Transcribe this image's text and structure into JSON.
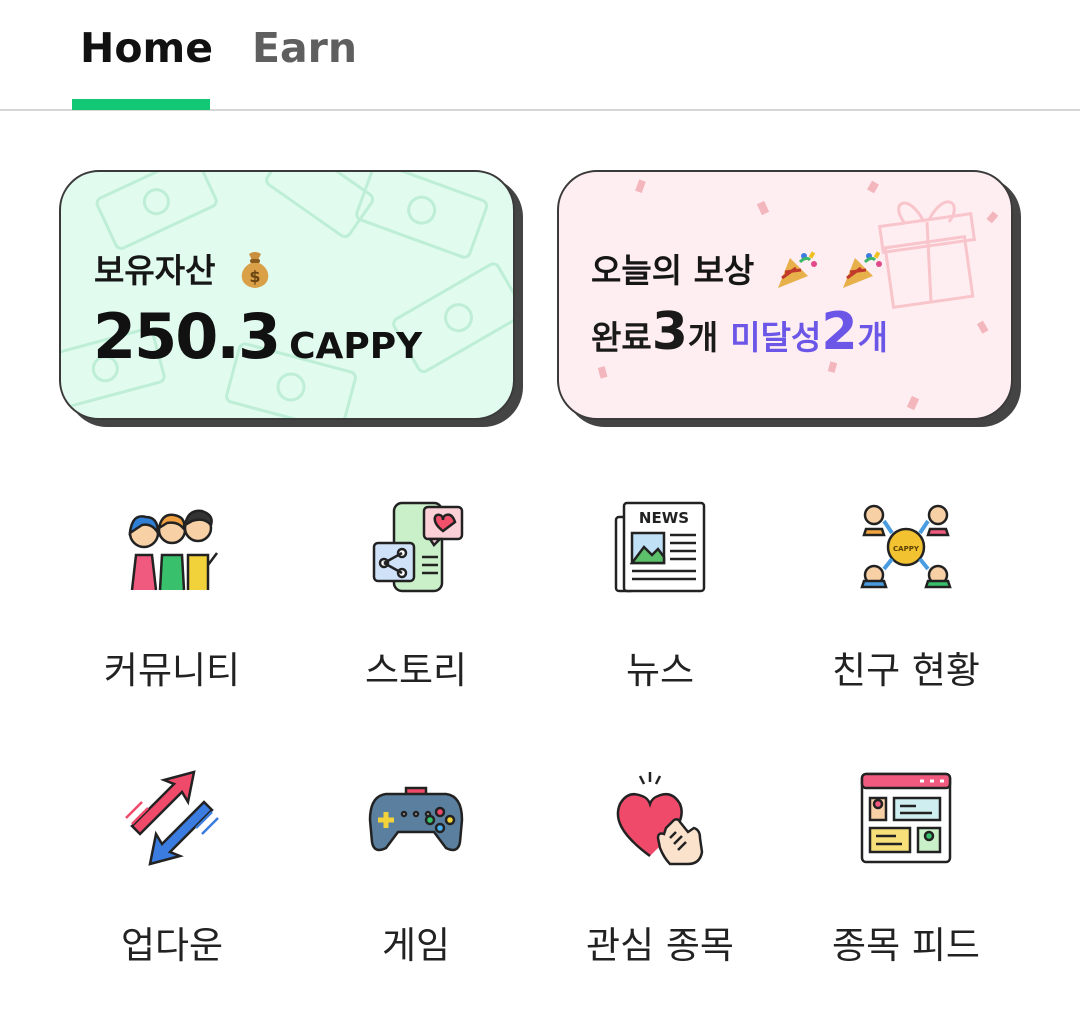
{
  "tabs": [
    {
      "label": "Home",
      "active": true
    },
    {
      "label": "Earn",
      "active": false
    }
  ],
  "accent_color": "#13c874",
  "assets_card": {
    "title": "보유자산",
    "emoji": "money-bag-icon",
    "amount": "250.3",
    "unit": "CAPPY",
    "bg_color": "#e1fbef"
  },
  "reward_card": {
    "title": "오늘의 보상",
    "emoji": "party-popper-icon",
    "completed_label": "완료",
    "completed_count": "3",
    "completed_unit": "개",
    "pending_label": "미달성",
    "pending_count": "2",
    "pending_unit": "개",
    "pending_color": "#6b56e8",
    "bg_color": "#ffeef1"
  },
  "menu": [
    {
      "label": "커뮤니티",
      "icon": "community-people-icon"
    },
    {
      "label": "스토리",
      "icon": "story-share-icon"
    },
    {
      "label": "뉴스",
      "icon": "newspaper-icon"
    },
    {
      "label": "친구 현황",
      "icon": "friends-network-icon"
    },
    {
      "label": "업다운",
      "icon": "up-down-arrows-icon"
    },
    {
      "label": "게임",
      "icon": "gamepad-icon"
    },
    {
      "label": "관심 종목",
      "icon": "heart-hand-icon"
    },
    {
      "label": "종목 피드",
      "icon": "feed-board-icon"
    }
  ]
}
